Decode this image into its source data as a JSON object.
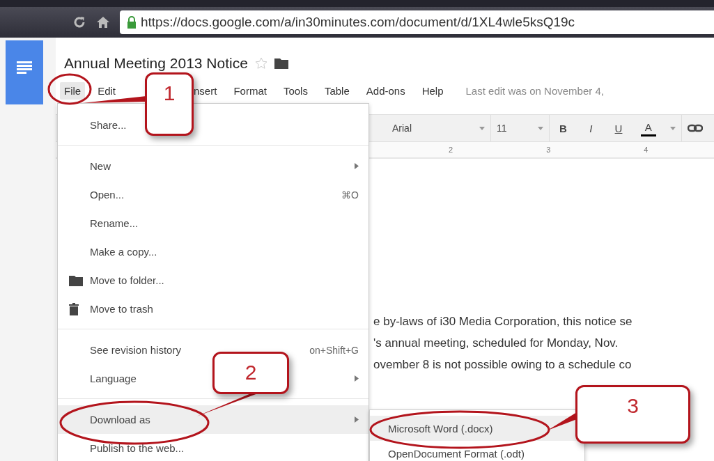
{
  "browser": {
    "url": "https://docs.google.com/a/in30minutes.com/document/d/1XL4wle5ksQ19c"
  },
  "document": {
    "title": "Annual Meeting 2013 Notice",
    "starred": false
  },
  "menu_bar": {
    "items": [
      {
        "label": "File",
        "selected": true
      },
      {
        "label": "Edit",
        "selected": false
      },
      {
        "label": "nsert",
        "selected": false
      },
      {
        "label": "Format",
        "selected": false
      },
      {
        "label": "Tools",
        "selected": false
      },
      {
        "label": "Table",
        "selected": false
      },
      {
        "label": "Add-ons",
        "selected": false
      },
      {
        "label": "Help",
        "selected": false
      }
    ],
    "last_edit": "Last edit was on November 4, "
  },
  "toolbar": {
    "font": "Arial",
    "size": "11",
    "buttons": [
      {
        "label": "B",
        "kind": "bold"
      },
      {
        "label": "I",
        "kind": "italic"
      },
      {
        "label": "U",
        "kind": "underline"
      },
      {
        "label": "A",
        "kind": "color"
      }
    ]
  },
  "ruler": {
    "marks": [
      "2",
      "3",
      "4"
    ]
  },
  "body_lines": [
    "e by-laws of i30 Media Corporation, this notice se",
    "'s annual meeting, scheduled for Monday, Nov. ",
    "ovember 8 is not possible owing to a schedule co"
  ],
  "file_menu": {
    "groups": [
      [
        {
          "kind": "text",
          "label": "Share...",
          "selected": false
        }
      ],
      [
        {
          "kind": "text",
          "label": "New",
          "submenu": true,
          "selected": false
        },
        {
          "kind": "text",
          "label": "Open...",
          "shortcut": "⌘O",
          "selected": false
        },
        {
          "kind": "text",
          "label": "Rename...",
          "selected": false
        },
        {
          "kind": "text",
          "label": "Make a copy...",
          "selected": false
        },
        {
          "kind": "folder",
          "label": "Move to folder...",
          "selected": false
        },
        {
          "kind": "trash",
          "label": "Move to trash",
          "selected": false
        }
      ],
      [
        {
          "kind": "text",
          "label": "See revision history",
          "shortcut": "on+Shift+G",
          "selected": false
        },
        {
          "kind": "text",
          "label": "Language",
          "submenu": true,
          "selected": false
        }
      ],
      [
        {
          "kind": "text",
          "label": "Download as",
          "submenu": true,
          "selected": true
        },
        {
          "kind": "text",
          "label": "Publish to the web...",
          "selected": false
        }
      ]
    ]
  },
  "download_submenu": {
    "items": [
      {
        "label": "Microsoft Word (.docx)",
        "selected": true
      },
      {
        "label": "OpenDocument Format (.odt)",
        "selected": false
      }
    ]
  },
  "callouts": [
    {
      "number": "1"
    },
    {
      "number": "2"
    },
    {
      "number": "3"
    }
  ]
}
